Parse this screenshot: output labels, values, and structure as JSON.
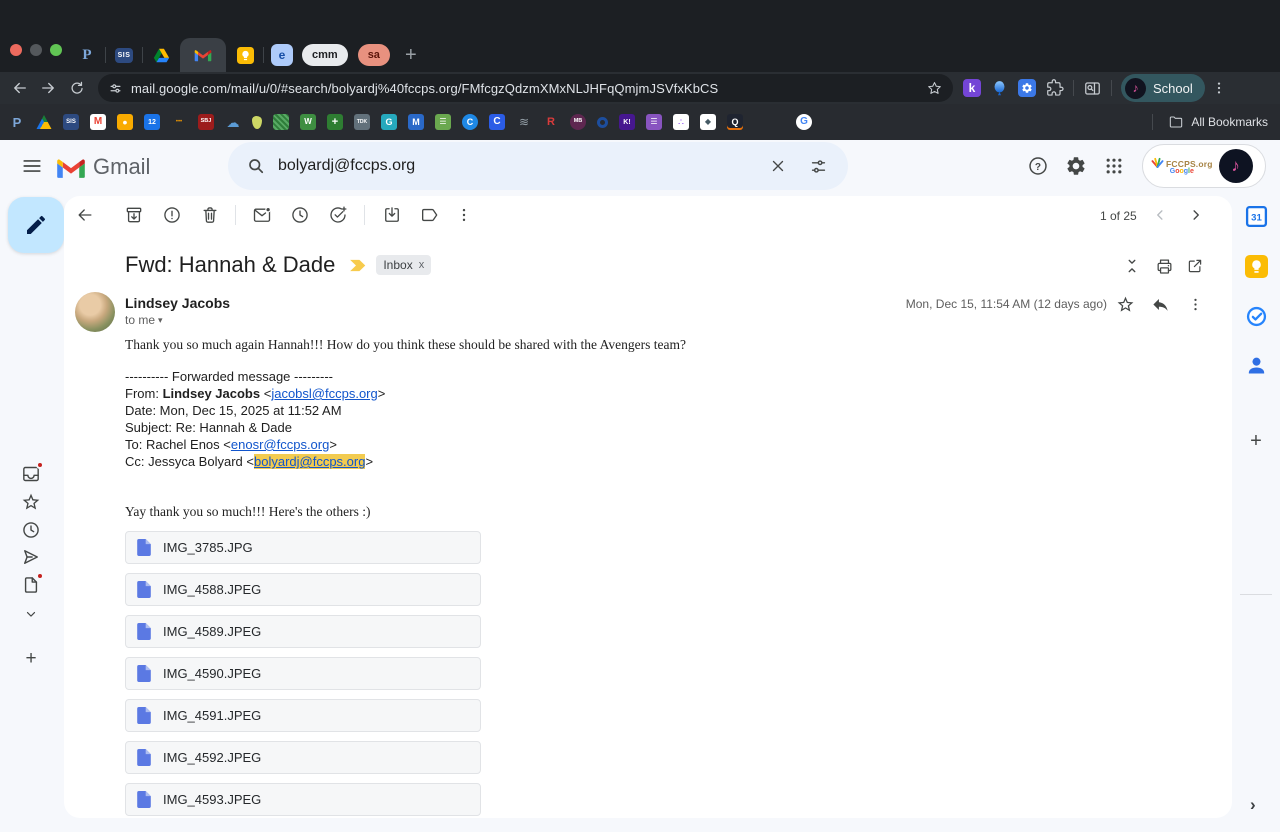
{
  "browser": {
    "pinned_tabs": {
      "powerschool": "P",
      "sis": "SIS",
      "e": "e",
      "cmm": "cmm",
      "sa": "sa"
    },
    "url": "mail.google.com/mail/u/0/#search/bolyardj%40fccps.org/FMfcgzQdzmXMxNLJHFqQmjmJSVfxKbCS",
    "extensions": {
      "kami": "k"
    },
    "profile": {
      "label": "School"
    },
    "bookmarks_label": "All Bookmarks",
    "bookmarks": [
      {
        "t": "P",
        "s": "background:transparent;color:#7da7d9;font-size:13px;font-weight:700"
      },
      {
        "t": "",
        "s": "background:conic-gradient(from 210deg,#1a73e8 0 120deg,#188038 0 240deg,#fbbc04 0);clip-path:polygon(50% 6%,97% 94%,3% 94%)"
      },
      {
        "t": "SIS",
        "s": "background:#2d4a80;color:#fff;font-size:6px;font-weight:700"
      },
      {
        "t": "M",
        "s": "background:#fff;color:#ea4335;font-size:10px;font-weight:900"
      },
      {
        "t": "•",
        "s": "background:#f9ab00;color:#fff;font-size:14px"
      },
      {
        "t": "12",
        "s": "background:#1a73e8;color:#fff;font-size:7px;font-weight:700"
      },
      {
        "t": "•••",
        "s": "background:transparent;color:#f29900;font-size:6px;letter-spacing:0"
      },
      {
        "t": "SBJ",
        "s": "background:#9c1c1c;color:#fff;font-size:5.5px;font-weight:700"
      },
      {
        "t": "☁",
        "s": "background:transparent;color:#5b9bd5;font-size:13px"
      },
      {
        "t": "",
        "s": "background:#cdd765;border-radius:46% 54% 48% 52%/30% 34% 66% 70%;width:10px;height:13px"
      },
      {
        "t": "",
        "s": "background:repeating-linear-gradient(45deg,#2f7d3a 0 2px,#58a864 2px 4px)"
      },
      {
        "t": "W",
        "s": "background:#3e8e41;color:#fff;font-size:8px;font-weight:700"
      },
      {
        "t": "+",
        "s": "background:#2e7d32;color:#fff;font-size:11px;font-weight:700"
      },
      {
        "t": "TDK",
        "s": "background:#62717b;color:#fff;font-size:5px;font-weight:700"
      },
      {
        "t": "G",
        "s": "background:#26a9bd;color:#fff;font-size:9px;font-weight:700"
      },
      {
        "t": "M",
        "s": "background:#2a69c8;color:#fff;font-size:9px;font-weight:700"
      },
      {
        "t": "☰",
        "s": "background:#6aa84f;color:#fff;font-size:8px"
      },
      {
        "t": "C",
        "s": "background:#1e88e5;color:#fff;border-radius:50%;font-size:9px;font-weight:700"
      },
      {
        "t": "C",
        "s": "background:#2b5ce6;color:#fff;font-size:10px;font-weight:700"
      },
      {
        "t": "≋",
        "s": "background:transparent;color:#95a0a8;font-size:12px"
      },
      {
        "t": "R",
        "s": "background:transparent;color:#d93b3b;font-size:11px;font-weight:700"
      },
      {
        "t": "MB",
        "s": "background:#5e2750;color:#fff;border-radius:50%;font-size:5.5px;font-weight:700"
      },
      {
        "t": "",
        "s": "background:transparent;border:3px solid #1d4e9e;border-radius:50%;width:11px;height:11px"
      },
      {
        "t": "K!",
        "s": "background:#46178f;color:#fff;font-size:7px;font-weight:800"
      },
      {
        "t": "☰",
        "s": "background:#8854c0;color:#fff;font-size:8px"
      },
      {
        "t": "∴",
        "s": "background:#fff;color:#7b2ff2;font-size:9px"
      },
      {
        "t": "◆",
        "s": "background:#fff;color:#455a64;font-size:8px"
      },
      {
        "t": "Q",
        "s": "background:#1f2430;color:#fff;font-size:9px;font-weight:700;box-shadow:inset 0 -2px 0 #e8710a"
      },
      {
        "t": "G",
        "s": "background:#fff;color:#4285f4;border-radius:50%;font-size:10px;font-weight:700;margin-left:42px"
      }
    ]
  },
  "icons": {
    "plus": "+",
    "help_mark": "?",
    "calendar_day": "31",
    "music_note": "♪",
    "dropdown_caret": "▾",
    "close_x": "x",
    "panel_chevron": "›"
  },
  "gmail": {
    "logo_text": "Gmail",
    "search": {
      "query": "bolyardj@fccps.org"
    },
    "list_position": "1 of 25",
    "profile_chip": {
      "org": "FCCPS.org",
      "google_brand": [
        "G",
        "o",
        "o",
        "g",
        "l",
        "e"
      ]
    },
    "email": {
      "subject": "Fwd: Hannah & Dade",
      "label": "Inbox",
      "sender_name": "Lindsey Jacobs",
      "to_line": "to me",
      "date_line": "Mon, Dec 15, 11:54 AM (12 days ago)",
      "intro": "Thank you so much again Hannah!!! How do you think these should be shared with the Avengers team?",
      "fwd": {
        "divider": "---------- Forwarded message ---------",
        "from_label": "From: ",
        "from_name": "Lindsey Jacobs",
        "from_email": "jacobsl@fccps.org",
        "date": "Date: Mon, Dec 15, 2025 at 11:52 AM",
        "subject": "Subject: Re: Hannah & Dade",
        "to_label": "To: Rachel Enos",
        "to_email": "enosr@fccps.org",
        "cc_label": "Cc: Jessyca Bolyard",
        "cc_email": "bolyardj@fccps.org",
        "lt": " <",
        "gt": ">"
      },
      "body2": "Yay thank you so much!!! Here's the others :)",
      "attachments": [
        "IMG_3785.JPG",
        "IMG_4588.JPEG",
        "IMG_4589.JPEG",
        "IMG_4590.JPEG",
        "IMG_4591.JPEG",
        "IMG_4592.JPEG",
        "IMG_4593.JPEG"
      ]
    }
  },
  "colors": {
    "traffic_red": "#ec6a5e",
    "traffic_gray": "#54585c",
    "traffic_green": "#61c554",
    "compose_bg": "#c2e7ff",
    "search_bg": "#eaf1fb",
    "link": "#1155cc",
    "highlight": "#f2cb50",
    "important_marker": "#f7cb4d",
    "attachment_icon": "#5b79e3",
    "notification_dot": "#c5221f"
  }
}
